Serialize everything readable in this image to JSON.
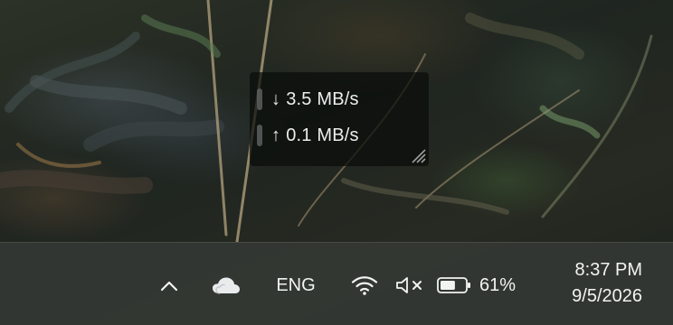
{
  "network_widget": {
    "download_arrow": "↓",
    "download_speed": "3.5 MB/s",
    "upload_arrow": "↑",
    "upload_speed": "0.1 MB/s"
  },
  "taskbar": {
    "tray_icons": {
      "overflow": "chevron-up-icon",
      "cloud": "onedrive-cloud-icon",
      "wifi": "wifi-icon",
      "volume": "volume-muted-icon",
      "battery": "battery-icon"
    },
    "language": "ENG",
    "battery_percent": "61%",
    "battery_level": 0.61,
    "time": "8:37 PM",
    "date": "9/5/2026"
  },
  "colors": {
    "taskbar_bg": "#34382f",
    "text": "#f2f4f2",
    "widget_bg": "#0a0c0a"
  }
}
